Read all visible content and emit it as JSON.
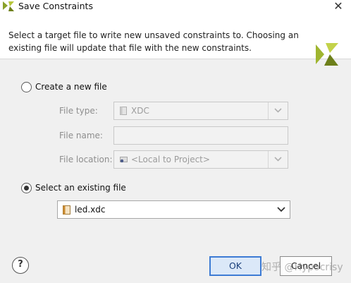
{
  "window": {
    "title": "Save Constraints",
    "close_glyph": "✕"
  },
  "banner": {
    "description": "Select a target file to write new unsaved constraints to. Choosing an existing file will update that file with the new constraints."
  },
  "create_new": {
    "label": "Create a new file",
    "selected": false,
    "file_type_label": "File type:",
    "file_type_value": "XDC",
    "file_name_label": "File name:",
    "file_name_value": "",
    "file_location_label": "File location:",
    "file_location_value": "<Local to Project>"
  },
  "select_existing": {
    "label": "Select an existing file",
    "selected": true,
    "file_value": "led.xdc"
  },
  "buttons": {
    "help": "?",
    "ok": "OK",
    "cancel": "Cancel"
  },
  "watermark": "知乎 @Hypocrisy",
  "colors": {
    "accent": "#3d7bd4",
    "logo_green_dark": "#7a8c1e",
    "logo_green_light": "#b6c63a"
  }
}
